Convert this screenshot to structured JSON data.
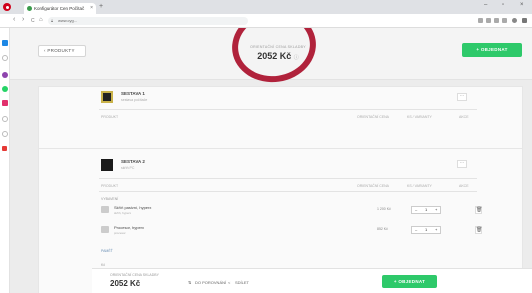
{
  "browser": {
    "tab_title": "Konfigurátor Cen Počítač",
    "tab_close": "×",
    "new_tab": "+",
    "url": "www.cyg...",
    "nav": {
      "back": "‹",
      "forward": "›",
      "reload": "C",
      "home": "⌂"
    },
    "window_controls": {
      "minimize": "–",
      "maximize": "▫",
      "close": "×"
    }
  },
  "header": {
    "back_label": "‹  PRODUKTY",
    "price_label": "ORIENTAČNÍ CENA SKLADBY",
    "price_value": "2052 Kč",
    "price_info": "ⓘ",
    "order_button": "+ OBJEDNAT"
  },
  "cards": [
    {
      "title": "SESTAVA 1",
      "subtitle": "sestava počítače",
      "menu": "···",
      "columns": [
        "PRODUKT",
        "ORIENTAČNÍ CENA",
        "KS / VARIANTY",
        "AKCE"
      ]
    },
    {
      "title": "SESTAVA 2",
      "subtitle": "skříň PC",
      "menu": "···",
      "columns": [
        "PRODUKT",
        "ORIENTAČNÍ CENA",
        "KS / VARIANTY",
        "AKCE"
      ],
      "section1": "VYBAVENÍ",
      "items": [
        {
          "title": "Skříň pasivní, hyperx",
          "sub": "skříň, hyperx",
          "price": "1 200 Kč",
          "qty": "1"
        },
        {
          "title": "Procesor, hyperx",
          "sub": "procesor",
          "price": "852 Kč",
          "qty": "1"
        }
      ],
      "section2": "PAMĚŤ",
      "extra_row": "Kč"
    }
  ],
  "bottom": {
    "price_label": "ORIENTAČNÍ CENA SKLADBY",
    "price_value": "2052 Kč",
    "action1": "DO POROVNÁNÍ",
    "action2": "SDÍLET",
    "order_button": "+ OBJEDNAT"
  },
  "colors": {
    "accent_green": "#2ec96a",
    "annotation_red": "#b0223b"
  }
}
